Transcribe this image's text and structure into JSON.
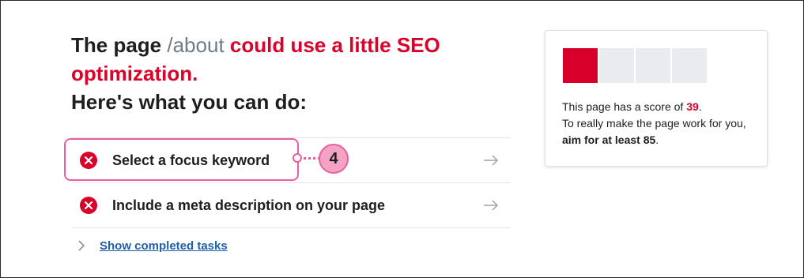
{
  "headline": {
    "prefix": "The page",
    "path": "/about",
    "warning": "could use a little SEO optimization.",
    "subtitle": "Here's what you can do:"
  },
  "tasks": [
    {
      "label": "Select a focus keyword",
      "status": "error",
      "icon": "x-circle-icon",
      "action_icon": "arrow-right-icon"
    },
    {
      "label": "Include a meta description on your page",
      "status": "error",
      "icon": "x-circle-icon",
      "action_icon": "arrow-right-icon"
    }
  ],
  "callout": {
    "step": "4",
    "color": "#e8609c"
  },
  "show_completed": {
    "label": "Show completed tasks",
    "icon": "chevron-right-icon"
  },
  "score_card": {
    "score": "39",
    "target": "85",
    "meter": {
      "segments": 4,
      "filled": 1
    },
    "line1_before": "This page has a score of ",
    "line1_after": ".",
    "line2_before": "To really make the page work for you, ",
    "line2_bold": "aim for at least 85",
    "line2_after": "."
  },
  "colors": {
    "error": "#d8002a",
    "link": "#1f5fa8",
    "highlight": "#e8609c",
    "muted_path": "#6f7b86"
  }
}
